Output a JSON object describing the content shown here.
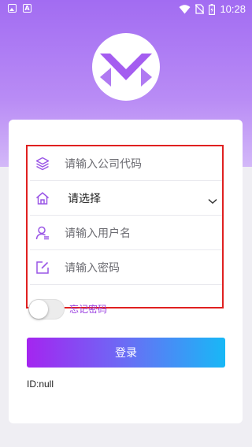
{
  "status_bar": {
    "time": "10:28",
    "left_icons": [
      "image-icon",
      "a-icon"
    ],
    "right_icons": [
      "wifi-icon",
      "no-sim-icon",
      "battery-icon"
    ]
  },
  "colors": {
    "brand": "#a26cf2",
    "logo_mark": "#a45df0",
    "button_gradient": [
      "#a425f0",
      "#18b8f6"
    ],
    "highlight_border": "#e02020",
    "link_purple": "#9a3fe0"
  },
  "form": {
    "company_code": {
      "placeholder": "请输入公司代码",
      "icon": "layers-icon"
    },
    "select": {
      "value": "请选择",
      "icon": "home-icon"
    },
    "username": {
      "placeholder": "请输入用户名",
      "icon": "user-icon"
    },
    "password": {
      "placeholder": "请输入密码",
      "icon": "edit-icon"
    }
  },
  "remember": {
    "label": "忘记密码",
    "on": false
  },
  "login_button": "登录",
  "id_text": "ID:null"
}
